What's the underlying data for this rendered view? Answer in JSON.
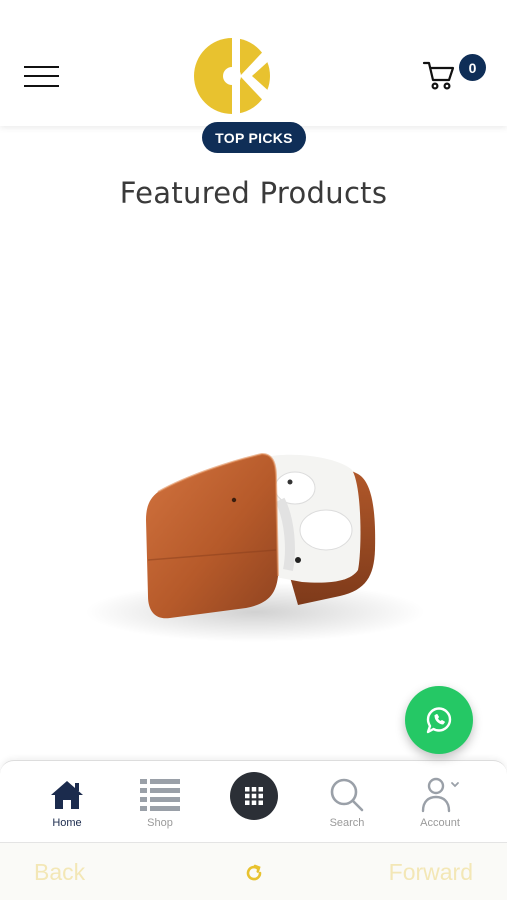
{
  "header": {
    "menu_icon": "hamburger-menu-icon",
    "logo_icon": "brand-logo",
    "cart_icon": "shopping-cart-icon",
    "cart_count": "0",
    "brand_color": "#e8c22f",
    "badge_color": "#0f2e57"
  },
  "section": {
    "badge": "TOP PICKS",
    "title": "Featured Products"
  },
  "whatsapp": {
    "icon": "whatsapp-icon",
    "color": "#25c865"
  },
  "tabbar": {
    "items": [
      {
        "label": "Home",
        "icon": "home-icon",
        "active": true
      },
      {
        "label": "Shop",
        "icon": "list-icon",
        "active": false
      },
      {
        "label": "",
        "icon": "grid-icon",
        "active": false
      },
      {
        "label": "Search",
        "icon": "search-icon",
        "active": false
      },
      {
        "label": "Account",
        "icon": "user-icon",
        "active": false
      }
    ]
  },
  "browser": {
    "back": "Back",
    "forward": "Forward",
    "reload_icon": "reload-icon"
  }
}
